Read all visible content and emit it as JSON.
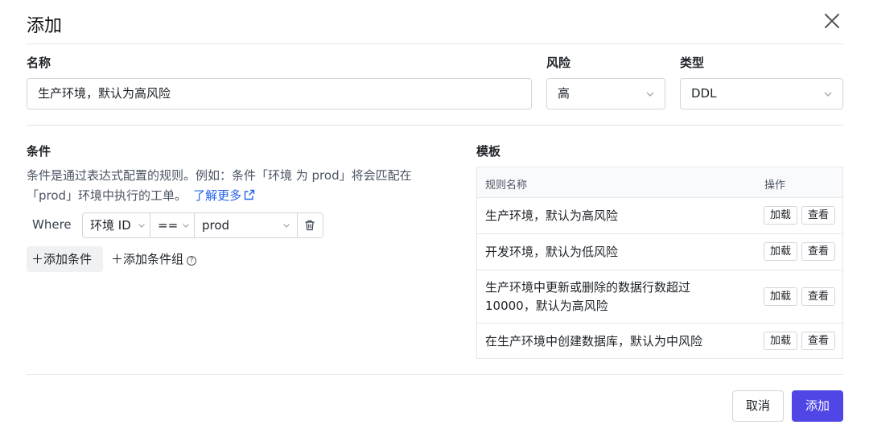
{
  "dialog": {
    "title": "添加"
  },
  "form": {
    "name_label": "名称",
    "name_value": "生产环境，默认为高风险",
    "risk_label": "风险",
    "risk_value": "高",
    "type_label": "类型",
    "type_value": "DDL"
  },
  "conditions": {
    "label": "条件",
    "description": "条件是通过表达式配置的规则。例如：条件「环境 为 prod」将会匹配在「prod」环境中执行的工单。",
    "learn_more": "了解更多",
    "where_label": "Where",
    "field": "环境 ID",
    "operator": "==",
    "value": "prod",
    "add_condition": "添加条件",
    "add_condition_group": "添加条件组"
  },
  "templates": {
    "label": "模板",
    "col_name": "规则名称",
    "col_ops": "操作",
    "load_label": "加载",
    "view_label": "查看",
    "rows": [
      {
        "name": "生产环境，默认为高风险"
      },
      {
        "name": "开发环境，默认为低风险"
      },
      {
        "name": "生产环境中更新或删除的数据行数超过 10000，默认为高风险"
      },
      {
        "name": "在生产环境中创建数据库，默认为中风险"
      }
    ]
  },
  "footer": {
    "cancel_label": "取消",
    "add_label": "添加"
  },
  "colors": {
    "primary": "#4f46e5",
    "link": "#2563eb",
    "border": "#d1d5db"
  }
}
